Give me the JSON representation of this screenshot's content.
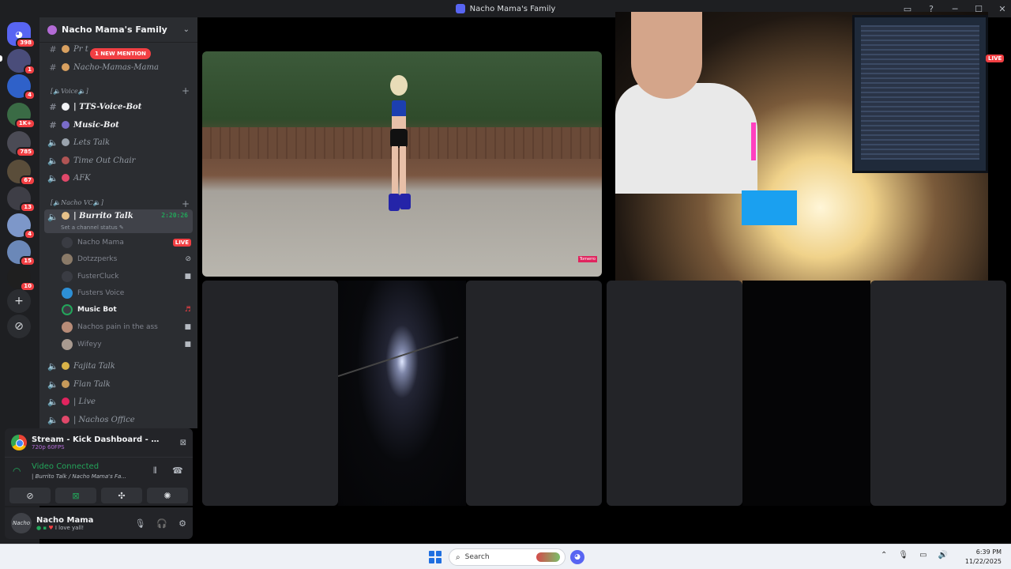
{
  "window": {
    "title": "Nacho Mama's Family"
  },
  "rail": {
    "items": [
      {
        "name": "direct-messages",
        "badge": "398"
      },
      {
        "name": "server-1",
        "badge": "1"
      },
      {
        "name": "server-2",
        "badge": "4"
      },
      {
        "name": "server-3",
        "badge": "1K+"
      },
      {
        "name": "server-4",
        "badge": "785"
      },
      {
        "name": "server-5",
        "badge": "67"
      },
      {
        "name": "server-6",
        "badge": "13"
      },
      {
        "name": "server-7",
        "badge": "4"
      },
      {
        "name": "server-8",
        "badge": "15"
      },
      {
        "name": "server-9",
        "badge": "10"
      }
    ],
    "add_label": "+",
    "explore_label": "⊘"
  },
  "server": {
    "name": "Nacho Mama's Family"
  },
  "mention_pill": "1 NEW MENTION",
  "channels": {
    "c1": "Pr         t",
    "c2": "Nacho-Mamas-Mama",
    "voice_category": "[🔈Voice🔈]",
    "c3": "| TTS-Voice-Bot",
    "c4": "Music-Bot",
    "c5": "Lets Talk",
    "c6": "Time Out Chair",
    "c7": "AFK",
    "vc_category": "[🔈Nacho VC🔈]",
    "active": "| Burrito Talk",
    "active_timer": "2:20:26",
    "channel_status": "Set a channel status",
    "c8": "Fajita Talk",
    "c9": "Flan Talk",
    "c10": "| Live",
    "c11": "| Nachos Office"
  },
  "voice_users": [
    {
      "name": "Nacho Mama",
      "badge": "LIVE"
    },
    {
      "name": "Dotzzperks"
    },
    {
      "name": "FusterCluck"
    },
    {
      "name": "Fusters Voice"
    },
    {
      "name": "Music Bot"
    },
    {
      "name": "Nachos pain in the ass"
    },
    {
      "name": "Wifeyy"
    }
  ],
  "stream": {
    "title": "Stream - Kick Dashboard - Google ...",
    "quality": "720p 60FPS"
  },
  "connection": {
    "status": "Video Connected",
    "channel": "| Burrito Talk / Nacho Mama's Fa..."
  },
  "user": {
    "name": "Nacho Mama",
    "status": "I love yall!",
    "avatar_text": "Nacho"
  },
  "video": {
    "live_badge": "LIVE",
    "watermark": "Tomerro"
  },
  "taskbar": {
    "search_placeholder": "Search",
    "time": "6:39 PM",
    "date": "11/22/2025"
  },
  "colors": {
    "accent": "#5865f2",
    "live": "#f23f43",
    "connected": "#23a55a"
  }
}
